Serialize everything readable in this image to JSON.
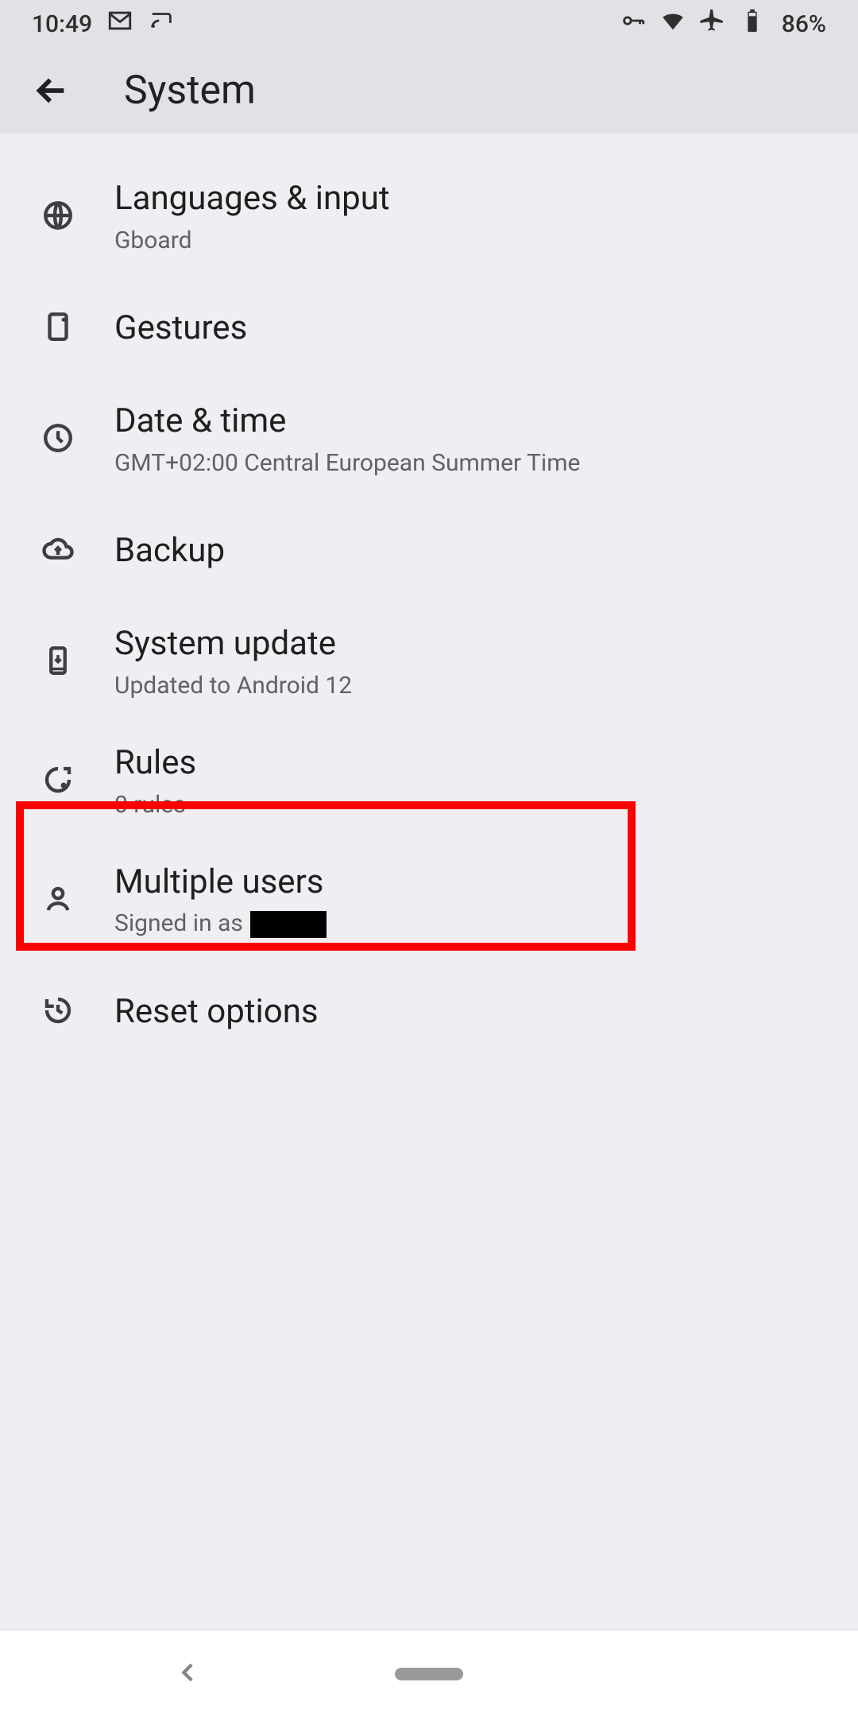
{
  "statusbar": {
    "time": "10:49",
    "battery_text": "86%"
  },
  "appbar": {
    "title": "System"
  },
  "items": [
    {
      "title": "Languages & input",
      "sub": "Gboard"
    },
    {
      "title": "Gestures",
      "sub": ""
    },
    {
      "title": "Date & time",
      "sub": "GMT+02:00 Central European Summer Time"
    },
    {
      "title": "Backup",
      "sub": ""
    },
    {
      "title": "System update",
      "sub": "Updated to Android 12"
    },
    {
      "title": "Rules",
      "sub": "0 rules"
    },
    {
      "title": "Multiple users",
      "sub_prefix": "Signed in as "
    },
    {
      "title": "Reset options",
      "sub": ""
    }
  ]
}
